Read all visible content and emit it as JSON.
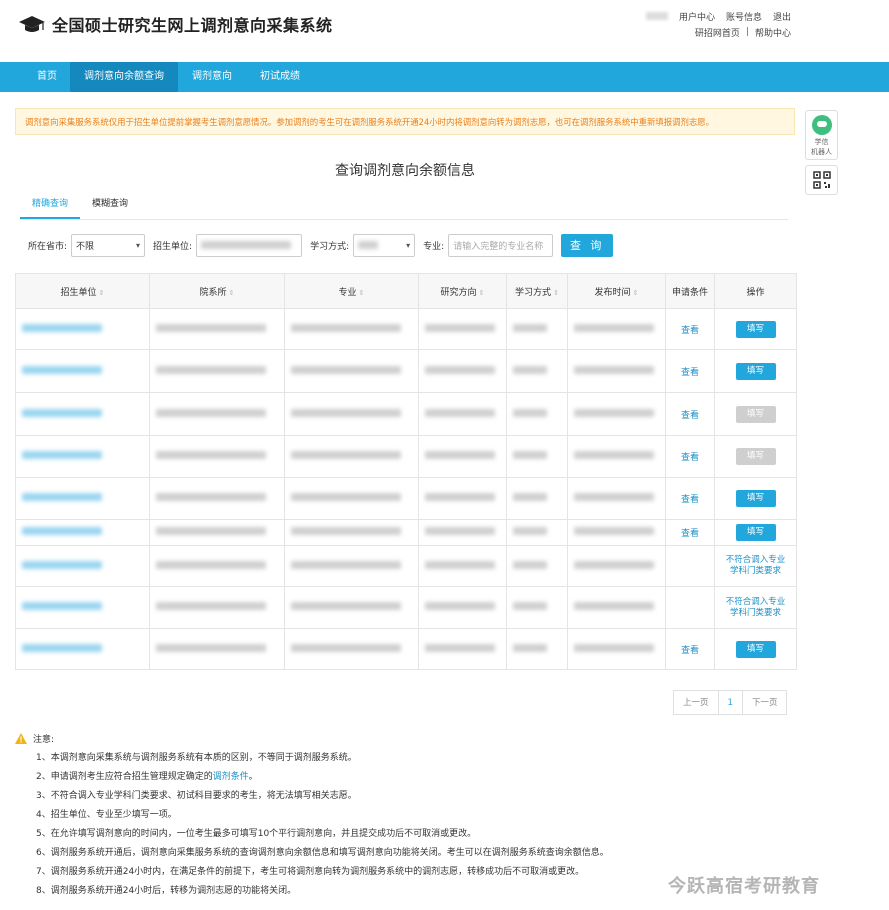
{
  "header": {
    "site_title": "全国硕士研究生网上调剂意向采集系统",
    "links_row1": [
      "用户中心",
      "账号信息",
      "退出"
    ],
    "links_row2": [
      "研招网首页",
      "|",
      "帮助中心"
    ]
  },
  "nav": {
    "items": [
      "首页",
      "调剂意向余额查询",
      "调剂意向",
      "初试成绩"
    ],
    "active_index": 1
  },
  "notice": "调剂意向采集服务系统仅用于招生单位提前掌握考生调剂意愿情况。参加调剂的考生可在调剂服务系统开通24小时内将调剂意向转为调剂志愿，也可在调剂服务系统中重新填报调剂志愿。",
  "side": {
    "robot_label_1": "学信",
    "robot_label_2": "机器人"
  },
  "page_title": "查询调剂意向余额信息",
  "tabs": [
    "精确查询",
    "模糊查询"
  ],
  "search": {
    "province_label": "所在省市:",
    "province_value": "不限",
    "unit_label": "招生单位:",
    "study_label": "学习方式:",
    "major_label": "专业:",
    "major_placeholder": "请输入完整的专业名称",
    "query_button": "查 询"
  },
  "table": {
    "headers": [
      "招生单位",
      "院系所",
      "专业",
      "研究方向",
      "学习方式",
      "发布时间",
      "申请条件",
      "操作"
    ],
    "view_label": "查看",
    "fill_label": "填写",
    "nofit_line1": "不符合调入专业",
    "nofit_line2": "学科门类要求",
    "rows": [
      {
        "view": true,
        "action": "fill"
      },
      {
        "view": true,
        "action": "fill"
      },
      {
        "view": true,
        "action": "disabled"
      },
      {
        "view": true,
        "action": "disabled"
      },
      {
        "view": true,
        "action": "fill"
      },
      {
        "view": true,
        "action": "fill"
      },
      {
        "view": false,
        "action": "nofit"
      },
      {
        "view": false,
        "action": "nofit"
      },
      {
        "view": true,
        "action": "fill"
      }
    ]
  },
  "pager": {
    "prev": "上一页",
    "page": "1",
    "next": "下一页"
  },
  "notes": {
    "title": "注意:",
    "items": [
      "1、本调剂意向采集系统与调剂服务系统有本质的区别，不等同于调剂服务系统。",
      "2、申请调剂考生应符合招生管理规定确定的",
      "3、不符合调入专业学科门类要求、初试科目要求的考生，将无法填写相关志愿。",
      "4、招生单位、专业至少填写一项。",
      "5、在允许填写调剂意向的时间内，一位考生最多可填写10个平行调剂意向，并且提交成功后不可取消或更改。",
      "6、调剂服务系统开通后，调剂意向采集服务系统的查询调剂意向余额信息和填写调剂意向功能将关闭。考生可以在调剂服务系统查询余额信息。",
      "7、调剂服务系统开通24小时内，在满足条件的前提下，考生可将调剂意向转为调剂服务系统中的调剂志愿，转移成功后不可取消或更改。",
      "8、调剂服务系统开通24小时后，转移为调剂志愿的功能将关闭。"
    ],
    "item2_link": "调剂条件",
    "item2_end": "。"
  },
  "watermark": "今跃高宿考研教育",
  "colors": {
    "accent": "#22a7dd",
    "nav_active": "#1588bd",
    "notice_text": "#e8811f"
  }
}
